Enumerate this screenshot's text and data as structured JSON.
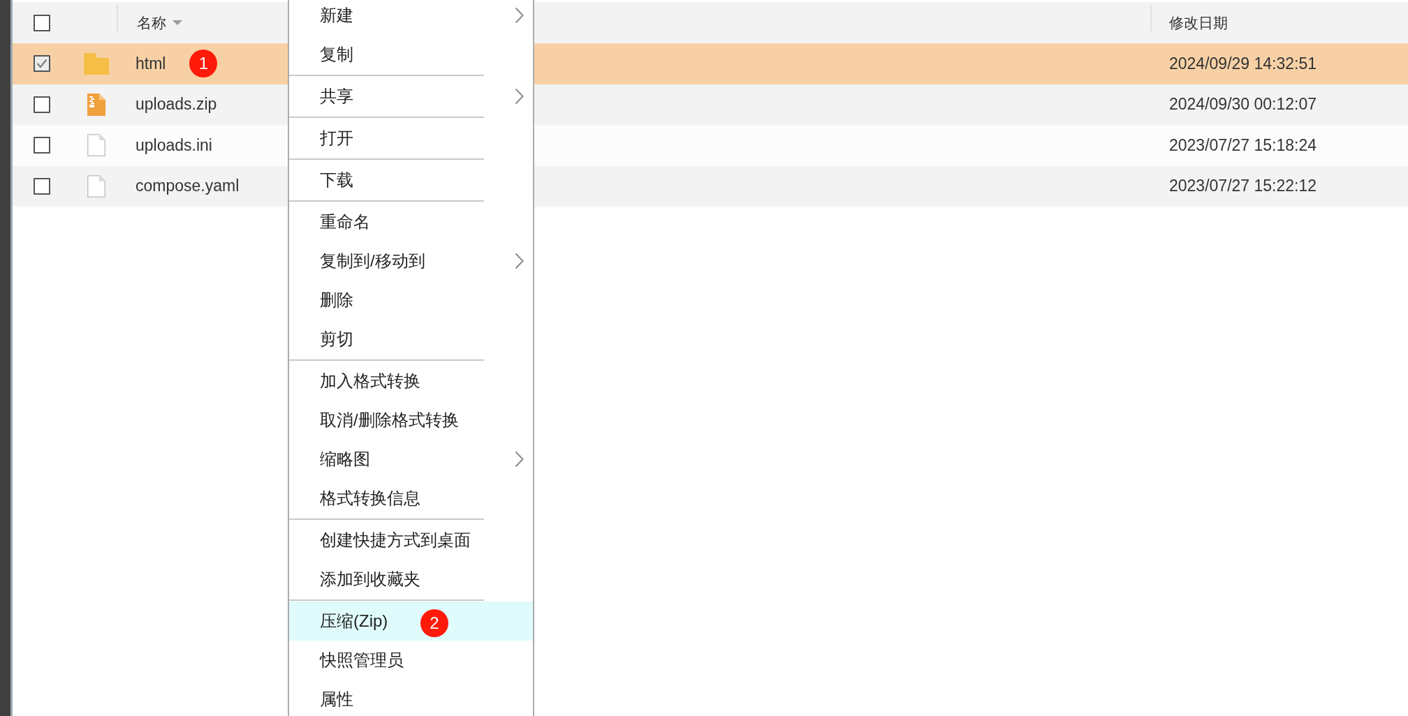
{
  "table": {
    "select_all": {
      "checked": false
    },
    "columns": [
      {
        "label": "名称",
        "sorted": true
      },
      {
        "label": "修改日期",
        "sorted": false
      }
    ],
    "rows": [
      {
        "name": "html",
        "kind": "folder",
        "checked": true,
        "selected": true,
        "marker": "1",
        "modified": "2024/09/29 14:32:51"
      },
      {
        "name": "uploads.zip",
        "kind": "zip",
        "checked": false,
        "selected": false,
        "modified": "2024/09/30 00:12:07"
      },
      {
        "name": "uploads.ini",
        "kind": "file",
        "checked": false,
        "selected": false,
        "modified": "2023/07/27 15:18:24"
      },
      {
        "name": "compose.yaml",
        "kind": "file",
        "checked": false,
        "selected": false,
        "modified": "2023/07/27 15:22:12"
      }
    ]
  },
  "context_menu": {
    "groups": [
      [
        {
          "label": "新建",
          "submenu": true,
          "highlighted": false
        },
        {
          "label": "复制",
          "submenu": false,
          "highlighted": false
        }
      ],
      [
        {
          "label": "共享",
          "submenu": true,
          "highlighted": false
        }
      ],
      [
        {
          "label": "打开",
          "submenu": false,
          "highlighted": false
        }
      ],
      [
        {
          "label": "下载",
          "submenu": false,
          "highlighted": false
        }
      ],
      [
        {
          "label": "重命名",
          "submenu": false,
          "highlighted": false
        },
        {
          "label": "复制到/移动到",
          "submenu": true,
          "highlighted": false
        },
        {
          "label": "删除",
          "submenu": false,
          "highlighted": false
        },
        {
          "label": "剪切",
          "submenu": false,
          "highlighted": false
        }
      ],
      [
        {
          "label": "加入格式转换",
          "submenu": false,
          "highlighted": false
        },
        {
          "label": "取消/删除格式转换",
          "submenu": false,
          "highlighted": false
        },
        {
          "label": "缩略图",
          "submenu": true,
          "highlighted": false
        },
        {
          "label": "格式转换信息",
          "submenu": false,
          "highlighted": false
        }
      ],
      [
        {
          "label": "创建快捷方式到桌面",
          "submenu": false,
          "highlighted": false
        },
        {
          "label": "添加到收藏夹",
          "submenu": false,
          "highlighted": false
        }
      ],
      [
        {
          "label": "压缩(Zip)",
          "submenu": false,
          "highlighted": true,
          "marker": "2"
        },
        {
          "label": "快照管理员",
          "submenu": false,
          "highlighted": false
        },
        {
          "label": "属性",
          "submenu": false,
          "highlighted": false
        }
      ]
    ]
  }
}
